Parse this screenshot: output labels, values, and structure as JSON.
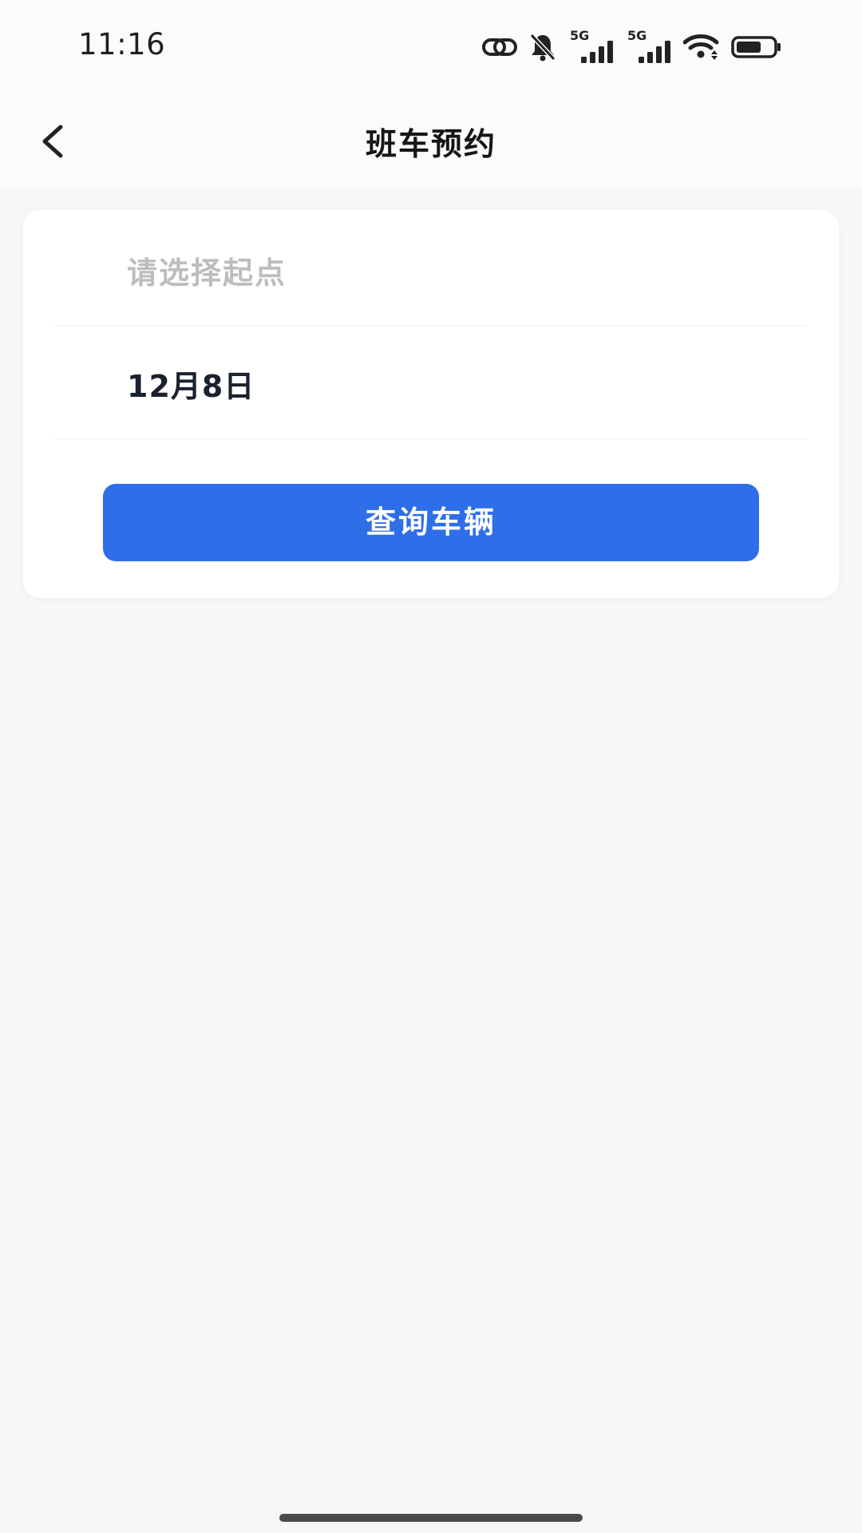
{
  "status_bar": {
    "time": "11:16",
    "network_tag_1": "5G",
    "network_tag_2": "5G",
    "icons": [
      "link-icon",
      "bell-muted-icon",
      "signal-icon",
      "signal-icon",
      "wifi-icon",
      "battery-icon"
    ]
  },
  "nav": {
    "title": "班车预约",
    "back_icon": "chevron-left-icon"
  },
  "form": {
    "origin_placeholder": "请选择起点",
    "date_value": "12月8日",
    "query_button_label": "查询车辆"
  },
  "colors": {
    "primary_button": "#2f6ee9",
    "background": "#f7f7f7",
    "card": "#ffffff"
  }
}
